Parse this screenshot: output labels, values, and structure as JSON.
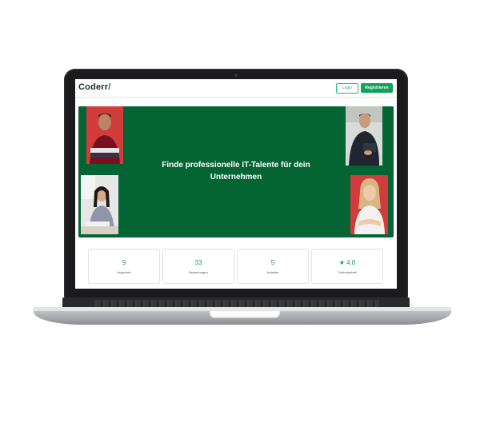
{
  "header": {
    "logo_main": "Coderr",
    "logo_slash": "/",
    "login_label": "Login",
    "register_label": "Registrieren"
  },
  "hero": {
    "title": "Finde professionelle IT-Talente für dein Unternehmen",
    "background_color": "#046433"
  },
  "stats": [
    {
      "value": "9",
      "label": "Angebote"
    },
    {
      "value": "33",
      "label": "Bewertungen"
    },
    {
      "value": "5",
      "label": "Anbieter"
    },
    {
      "value": "★ 4.8",
      "label": "Zufriedenheit"
    }
  ],
  "colors": {
    "accent": "#14a05c",
    "red_tile": "#d23b3b"
  }
}
